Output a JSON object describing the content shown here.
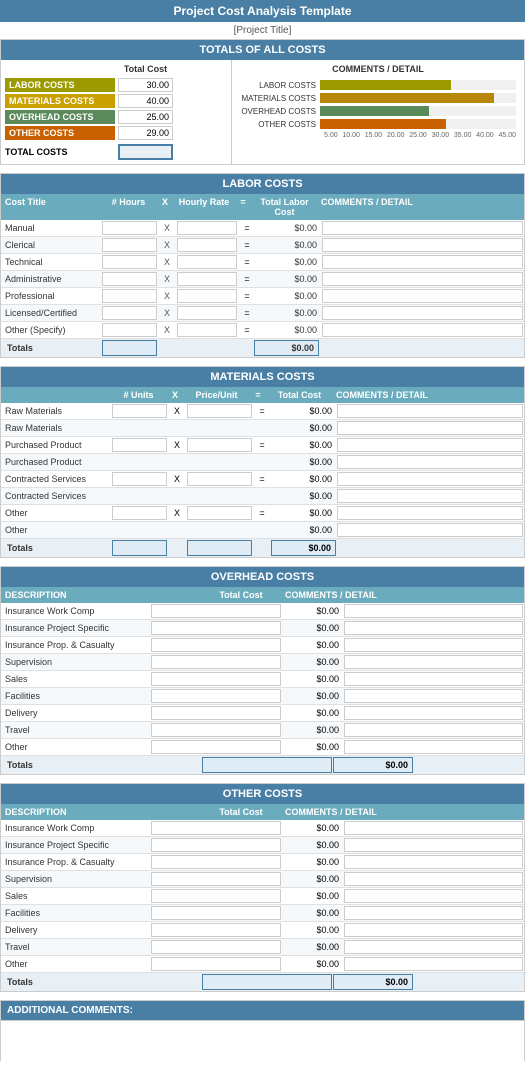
{
  "header": {
    "title": "Project Cost Analysis Template",
    "subtitle": "[Project Title]"
  },
  "totals_section": {
    "header": "TOTALS OF ALL COSTS",
    "col_total": "Total Cost",
    "col_comments": "COMMENTS / DETAIL",
    "rows": [
      {
        "label": "LABOR COSTS",
        "value": "30.00",
        "color": "labor"
      },
      {
        "label": "MATERIALS COSTS",
        "value": "40.00",
        "color": "materials"
      },
      {
        "label": "OVERHEAD COSTS",
        "value": "25.00",
        "color": "overhead"
      },
      {
        "label": "OTHER COSTS",
        "value": "29.00",
        "color": "other"
      }
    ],
    "total_label": "TOTAL COSTS",
    "chart": {
      "bars": [
        {
          "label": "LABOR COSTS",
          "value": 30,
          "max": 45,
          "color": "#9b9b00"
        },
        {
          "label": "MATERIALS COSTS",
          "value": 40,
          "max": 45,
          "color": "#b8860b"
        },
        {
          "label": "OVERHEAD COSTS",
          "value": 25,
          "max": 45,
          "color": "#5a8a5a"
        },
        {
          "label": "OTHER COSTS",
          "value": 29,
          "max": 45,
          "color": "#c86000"
        }
      ],
      "axis": [
        "5.00",
        "10.00",
        "15.00",
        "20.00",
        "25.00",
        "30.00",
        "35.00",
        "40.00",
        "45.00"
      ]
    }
  },
  "labor_section": {
    "header": "LABOR COSTS",
    "columns": [
      "Cost Title",
      "# Hours",
      "X",
      "Hourly Rate",
      "=",
      "Total Labor Cost",
      "COMMENTS / DETAIL"
    ],
    "rows": [
      {
        "label": "Manual",
        "total": "$0.00"
      },
      {
        "label": "Clerical",
        "total": "$0.00"
      },
      {
        "label": "Technical",
        "total": "$0.00"
      },
      {
        "label": "Administrative",
        "total": "$0.00"
      },
      {
        "label": "Professional",
        "total": "$0.00"
      },
      {
        "label": "Licensed/Certified",
        "total": "$0.00"
      },
      {
        "label": "Other (Specify)",
        "total": "$0.00"
      }
    ],
    "totals_label": "Totals",
    "totals_value": "$0.00"
  },
  "materials_section": {
    "header": "MATERIALS COSTS",
    "columns": [
      "",
      "# Units",
      "X",
      "Price/Unit",
      "=",
      "Total Cost",
      "COMMENTS / DETAIL"
    ],
    "rows": [
      {
        "label": "Raw Materials",
        "total": "$0.00",
        "has_x": true
      },
      {
        "label": "Raw Materials",
        "total": "$0.00",
        "has_x": false
      },
      {
        "label": "Purchased Product",
        "total": "$0.00",
        "has_x": true
      },
      {
        "label": "Purchased Product",
        "total": "$0.00",
        "has_x": false
      },
      {
        "label": "Contracted Services",
        "total": "$0.00",
        "has_x": true
      },
      {
        "label": "Contracted Services",
        "total": "$0.00",
        "has_x": false
      },
      {
        "label": "Other",
        "total": "$0.00",
        "has_x": true
      },
      {
        "label": "Other",
        "total": "$0.00",
        "has_x": false
      }
    ],
    "totals_label": "Totals",
    "totals_value": "$0.00"
  },
  "overhead_section": {
    "header": "OVERHEAD COSTS",
    "columns": [
      "DESCRIPTION",
      "Total Cost",
      "COMMENTS / DETAIL"
    ],
    "rows": [
      {
        "label": "Insurance Work Comp",
        "total": "$0.00"
      },
      {
        "label": "Insurance Project Specific",
        "total": "$0.00"
      },
      {
        "label": "Insurance Prop. & Casualty",
        "total": "$0.00"
      },
      {
        "label": "Supervision",
        "total": "$0.00"
      },
      {
        "label": "Sales",
        "total": "$0.00"
      },
      {
        "label": "Facilities",
        "total": "$0.00"
      },
      {
        "label": "Delivery",
        "total": "$0.00"
      },
      {
        "label": "Travel",
        "total": "$0.00"
      },
      {
        "label": "Other",
        "total": "$0.00"
      }
    ],
    "totals_label": "Totals",
    "totals_value": "$0.00"
  },
  "other_costs_section": {
    "header": "OTHER COSTS",
    "columns": [
      "DESCRIPTION",
      "Total Cost",
      "COMMENTS / DETAIL"
    ],
    "rows": [
      {
        "label": "Insurance Work Comp",
        "total": "$0.00"
      },
      {
        "label": "Insurance Project Specific",
        "total": "$0.00"
      },
      {
        "label": "Insurance Prop. & Casualty",
        "total": "$0.00"
      },
      {
        "label": "Supervision",
        "total": "$0.00"
      },
      {
        "label": "Sales",
        "total": "$0.00"
      },
      {
        "label": "Facilities",
        "total": "$0.00"
      },
      {
        "label": "Delivery",
        "total": "$0.00"
      },
      {
        "label": "Travel",
        "total": "$0.00"
      },
      {
        "label": "Other",
        "total": "$0.00"
      }
    ],
    "totals_label": "Totals",
    "totals_value": "$0.00"
  },
  "additional_comments": {
    "header": "ADDITIONAL COMMENTS:"
  }
}
